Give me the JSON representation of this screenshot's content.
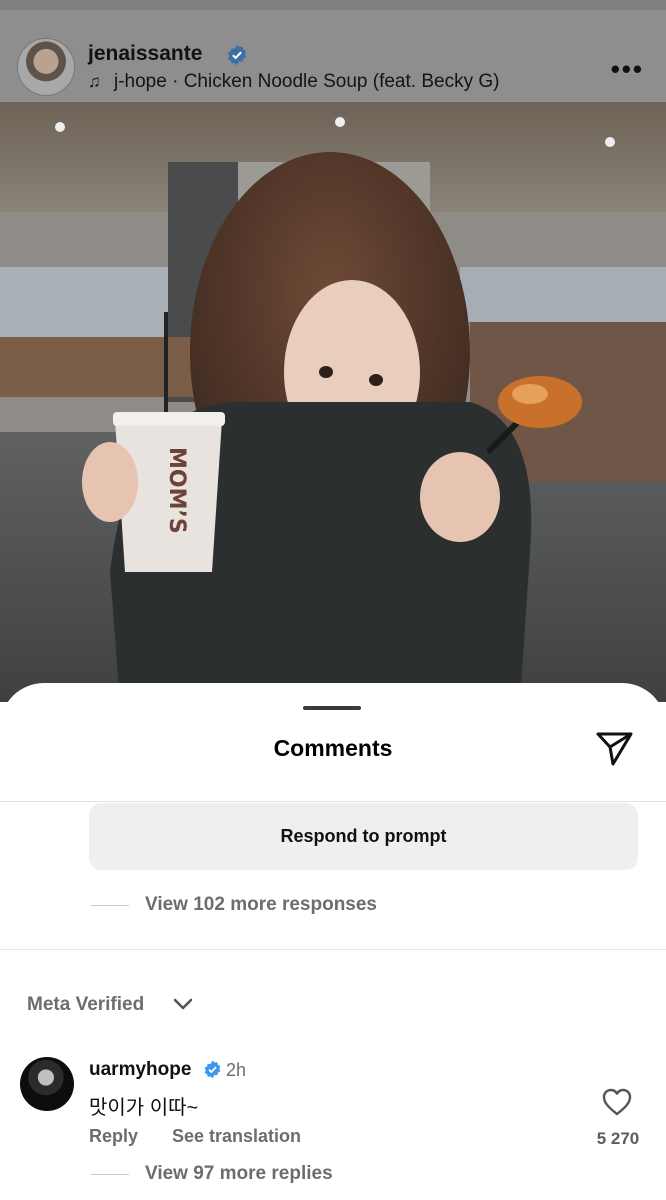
{
  "post": {
    "username": "jenaissante",
    "music": "j-hope · Chicken Noodle Soup (feat. Becky G)",
    "more_label": "•••",
    "photo_cup_text": "MOM’S"
  },
  "comments": {
    "title": "Comments",
    "respond_button": "Respond to prompt",
    "view_responses": "View 102 more responses",
    "filter_label": "Meta Verified",
    "items": [
      {
        "username": "uarmyhope",
        "time": "2h",
        "text": "맛이가 이따~",
        "reply_label": "Reply",
        "translate_label": "See translation",
        "likes": "5 270",
        "view_replies": "View 97 more replies"
      }
    ]
  },
  "colors": {
    "verified": "#3897f0",
    "secondary_text": "#6d6d6d",
    "button_bg": "#efeff2"
  },
  "icons": {
    "music": "music-note-icon",
    "share": "paper-plane-icon",
    "like": "heart-icon",
    "filter": "chevron-down-icon",
    "verified": "verified-badge-icon"
  }
}
